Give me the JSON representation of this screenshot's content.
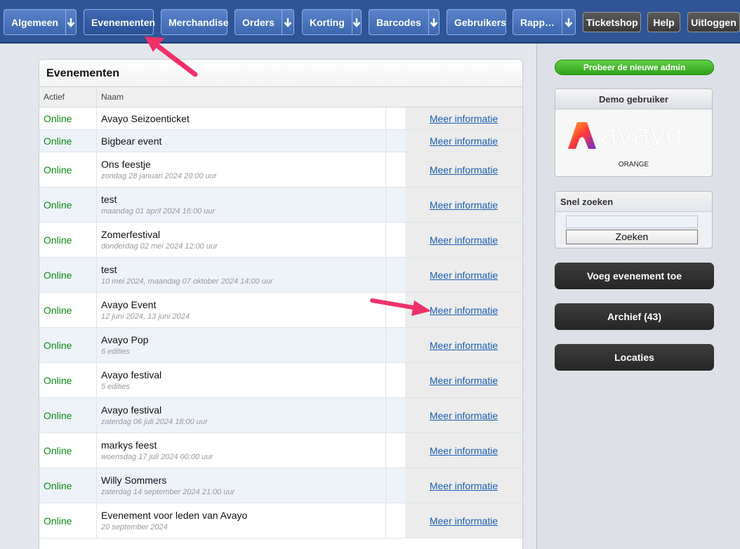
{
  "nav": {
    "items": [
      {
        "label": "Algemeen",
        "dropdown": true
      },
      {
        "label": "Evenementen",
        "dropdown": false,
        "active": true
      },
      {
        "label": "Merchandise",
        "dropdown": false
      },
      {
        "label": "Orders",
        "dropdown": true
      },
      {
        "label": "Korting",
        "dropdown": true
      },
      {
        "label": "Barcodes",
        "dropdown": true
      },
      {
        "label": "Gebruikers",
        "dropdown": false
      },
      {
        "label": "Rapp…",
        "dropdown": true
      }
    ],
    "right": [
      "Ticketshop",
      "Help",
      "Uitloggen"
    ]
  },
  "events": {
    "title": "Evenementen",
    "columns": [
      "Actief",
      "Naam"
    ],
    "link_label": "Meer informatie",
    "rows": [
      {
        "status": "Online",
        "name": "Avayo Seizoenticket",
        "sub": ""
      },
      {
        "status": "Online",
        "name": "Bigbear event",
        "sub": ""
      },
      {
        "status": "Online",
        "name": "Ons feestje",
        "sub": "zondag 28 januari 2024 20:00 uur"
      },
      {
        "status": "Online",
        "name": "test",
        "sub": "maandag 01 april 2024 16:00 uur"
      },
      {
        "status": "Online",
        "name": "Zomerfestival",
        "sub": "donderdag 02 mei 2024 12:00 uur"
      },
      {
        "status": "Online",
        "name": "test",
        "sub": "10 mei 2024, maandag 07 oktober 2024 14:00 uur"
      },
      {
        "status": "Online",
        "name": "Avayo Event",
        "sub": "12 juni 2024, 13 juni 2024"
      },
      {
        "status": "Online",
        "name": "Avayo Pop",
        "sub": "6 edities"
      },
      {
        "status": "Online",
        "name": "Avayo festival",
        "sub": "5 edities"
      },
      {
        "status": "Online",
        "name": "Avayo festival",
        "sub": "zaterdag 06 juli 2024 18:00 uur"
      },
      {
        "status": "Online",
        "name": "markys feest",
        "sub": "woensdag 17 juli 2024 00:00 uur"
      },
      {
        "status": "Online",
        "name": "Willy Sommers",
        "sub": "zaterdag 14 september 2024 21:00 uur"
      },
      {
        "status": "Online",
        "name": "Evenement voor leden van Avayo",
        "sub": "20 september 2024"
      }
    ]
  },
  "sidebar": {
    "new_admin": "Probeer de nieuwe admin",
    "demo_title": "Demo gebruiker",
    "logo_text": "avayo",
    "demo_caption": "ORANGE",
    "search_title": "Snel zoeken",
    "search_value": "",
    "search_button": "Zoeken",
    "add_event": "Voeg evenement toe",
    "archive": "Archief (43)",
    "locations": "Locaties"
  },
  "colors": {
    "nav_bg": "#2f5597",
    "status_online": "#0c8a15",
    "link": "#1a5fb4",
    "annotation_arrow": "#f0306a"
  }
}
